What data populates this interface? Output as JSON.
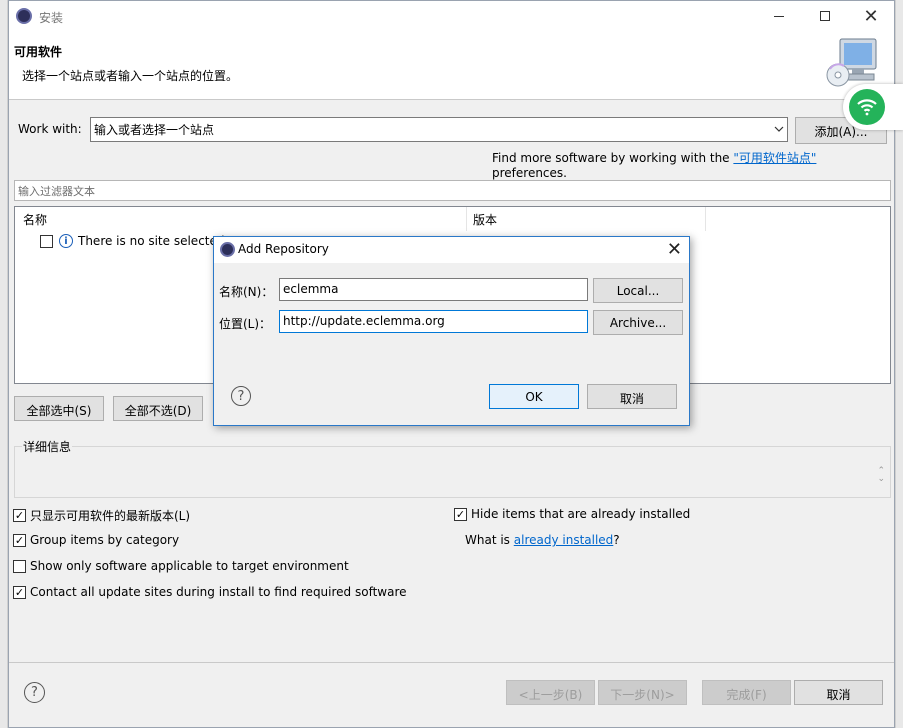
{
  "window": {
    "title": "安装",
    "close_glyph": "✕"
  },
  "header": {
    "title": "可用软件",
    "description": "选择一个站点或者输入一个站点的位置。"
  },
  "work_with": {
    "label": "Work with:",
    "value": "输入或者选择一个站点",
    "add_label": "添加(A)..."
  },
  "find_more": {
    "prefix": "Find more software by working with the ",
    "link": "\"可用软件站点\"",
    "suffix": " preferences."
  },
  "filter": {
    "placeholder": "输入过滤器文本"
  },
  "tree": {
    "col_name": "名称",
    "col_version": "版本",
    "row_text": "There is no site selected."
  },
  "selection_buttons": {
    "select_all": "全部选中(S)",
    "deselect_all": "全部不选(D)"
  },
  "details": {
    "label": "详细信息"
  },
  "options": {
    "latest_only": {
      "label": "只显示可用软件的最新版本(L)",
      "checked": true
    },
    "group_by_category": {
      "label": "Group items by category",
      "checked": true
    },
    "target_env_only": {
      "label": "Show only software applicable to target environment",
      "checked": false
    },
    "contact_all_sites": {
      "label": "Contact all update sites during install to find required software",
      "checked": true
    },
    "hide_installed": {
      "label": "Hide items that are already installed",
      "checked": true
    }
  },
  "what_is": {
    "prefix": "What is ",
    "link": "already installed",
    "suffix": "?"
  },
  "nav": {
    "help": "?",
    "back": "<上一步(B)",
    "next": "下一步(N)>",
    "finish": "完成(F)",
    "cancel": "取消"
  },
  "dialog": {
    "title": "Add Repository",
    "name_label": "名称(N)：",
    "name_value": "eclemma",
    "local_button": "Local...",
    "location_label": "位置(L)：",
    "location_value": "http://update.eclemma.org",
    "archive_button": "Archive...",
    "help": "?",
    "ok": "OK",
    "cancel": "取消"
  },
  "colors": {
    "link": "#0066cc",
    "focus_border": "#0078d7",
    "wifi_badge": "#24b35a"
  }
}
